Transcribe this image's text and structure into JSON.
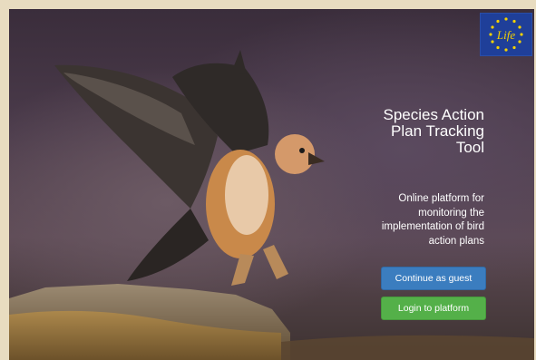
{
  "logo": {
    "text": "Life",
    "icon": "eu-life-logo"
  },
  "hero": {
    "title_lines": [
      "Species Action",
      "Plan Tracking",
      "Tool"
    ],
    "subtitle_lines": [
      "Online platform for",
      "monitoring the",
      "implementation of bird",
      "action plans"
    ]
  },
  "buttons": {
    "guest_label": "Continue as guest",
    "login_label": "Login to platform"
  },
  "colors": {
    "guest_button": "#3b7dbf",
    "login_button": "#54b049",
    "logo_blue": "#1f3f99"
  }
}
